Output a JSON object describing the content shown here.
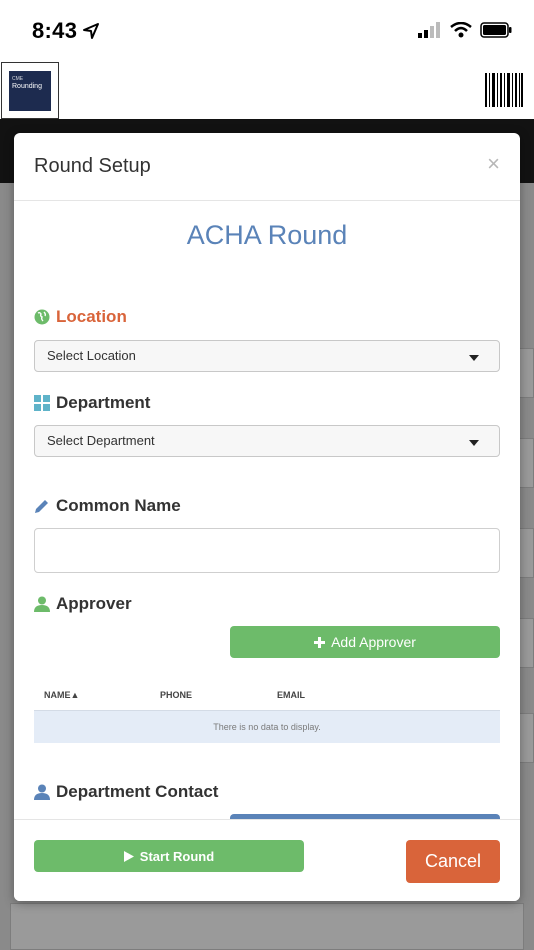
{
  "status_bar": {
    "time": "8:43"
  },
  "header": {
    "logo_small": "CME",
    "logo_text": "Rounding"
  },
  "modal": {
    "title": "Round Setup",
    "close_glyph": "×",
    "round_name": "ACHA Round",
    "location": {
      "label": "Location",
      "placeholder": "Select Location"
    },
    "department": {
      "label": "Department",
      "placeholder": "Select Department"
    },
    "common_name": {
      "label": "Common Name",
      "value": ""
    },
    "approver": {
      "label": "Approver",
      "add_button": "Add Approver",
      "columns": [
        "NAME▲",
        "PHONE",
        "EMAIL"
      ],
      "empty_text": "There is no data to display."
    },
    "department_contact": {
      "label": "Department Contact"
    },
    "footer": {
      "start_button": "Start Round",
      "cancel_button": "Cancel"
    }
  },
  "colors": {
    "accent_blue": "#5a83b8",
    "accent_orange": "#d9643a",
    "accent_green": "#6dbb6a"
  },
  "icons": {
    "location": "globe-icon",
    "department": "grid-icon",
    "common_name": "pencil-icon",
    "approver": "user-icon",
    "department_contact": "user-icon",
    "add": "plus-icon",
    "start": "play-icon"
  }
}
